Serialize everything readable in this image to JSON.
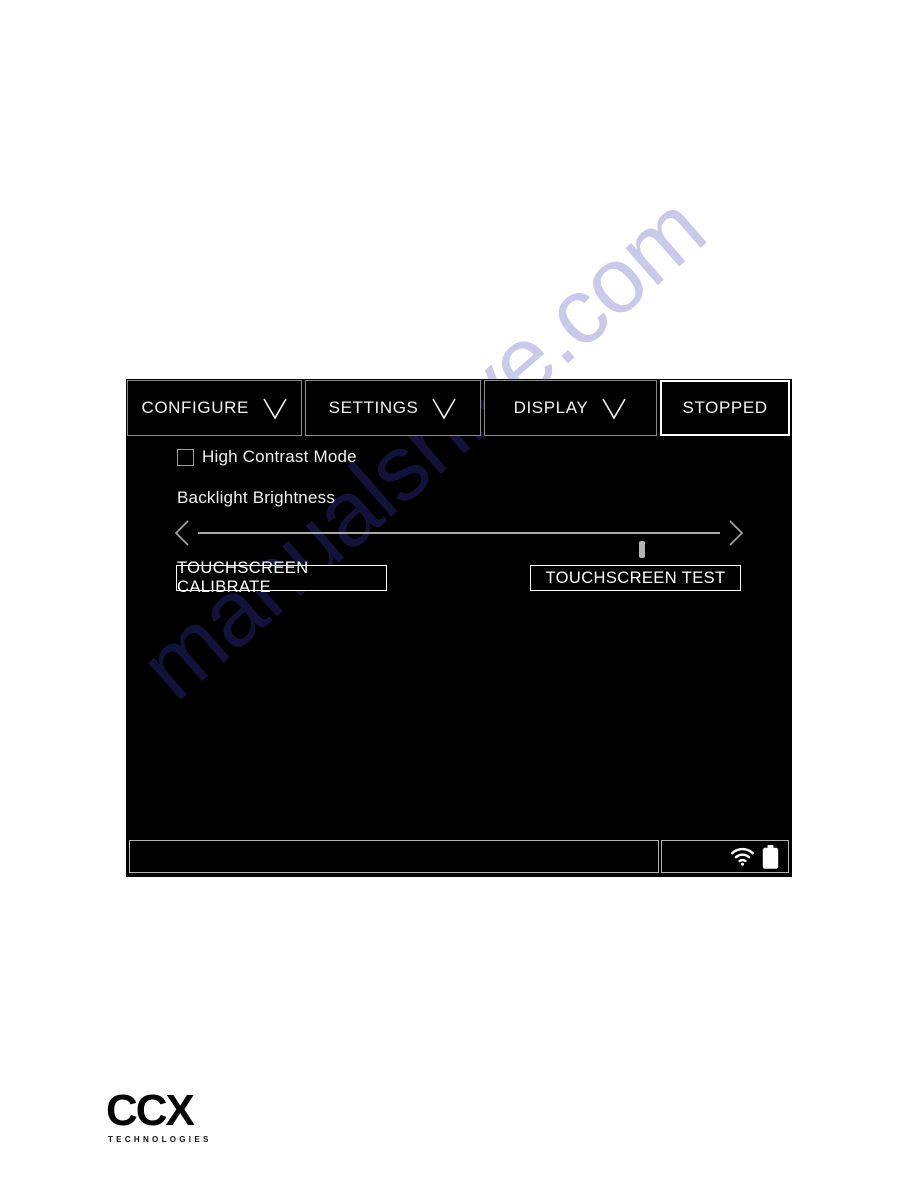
{
  "watermark": {
    "text": "manualshive.com",
    "color": "#c9c9ea"
  },
  "device": {
    "tab_bar": {
      "tabs": [
        {
          "label": "CONFIGURE",
          "icon": "chevron-down-icon",
          "has_caret": true,
          "active": false
        },
        {
          "label": "SETTINGS",
          "icon": "chevron-down-icon",
          "has_caret": true,
          "active": false
        },
        {
          "label": "DISPLAY",
          "icon": "chevron-down-icon",
          "has_caret": true,
          "active": true
        },
        {
          "label": "STOPPED",
          "icon": "",
          "has_caret": false,
          "active": false
        }
      ]
    },
    "display_settings": {
      "high_contrast": {
        "label": "High Contrast Mode",
        "checked": false
      },
      "backlight": {
        "label": "Backlight Brightness",
        "value_percent": 85,
        "decrease_icon": "chevron-left-icon",
        "increase_icon": "chevron-right-icon"
      },
      "buttons": {
        "calibrate_label": "TOUCHSCREEN CALIBRATE",
        "test_label": "TOUCHSCREEN TEST"
      }
    },
    "status_bar": {
      "message": "",
      "icons": [
        {
          "name": "wifi-icon"
        },
        {
          "name": "battery-icon"
        }
      ]
    },
    "colors": {
      "screen_background": "#000000",
      "text": "#f2f2f2",
      "tab_border": "#8a8a8a",
      "active_tab_border": "#ffffff",
      "slider_track": "#a8a8a8"
    }
  },
  "footer": {
    "logo_mark": "CCX",
    "logo_subtitle": "TECHNOLOGIES"
  }
}
